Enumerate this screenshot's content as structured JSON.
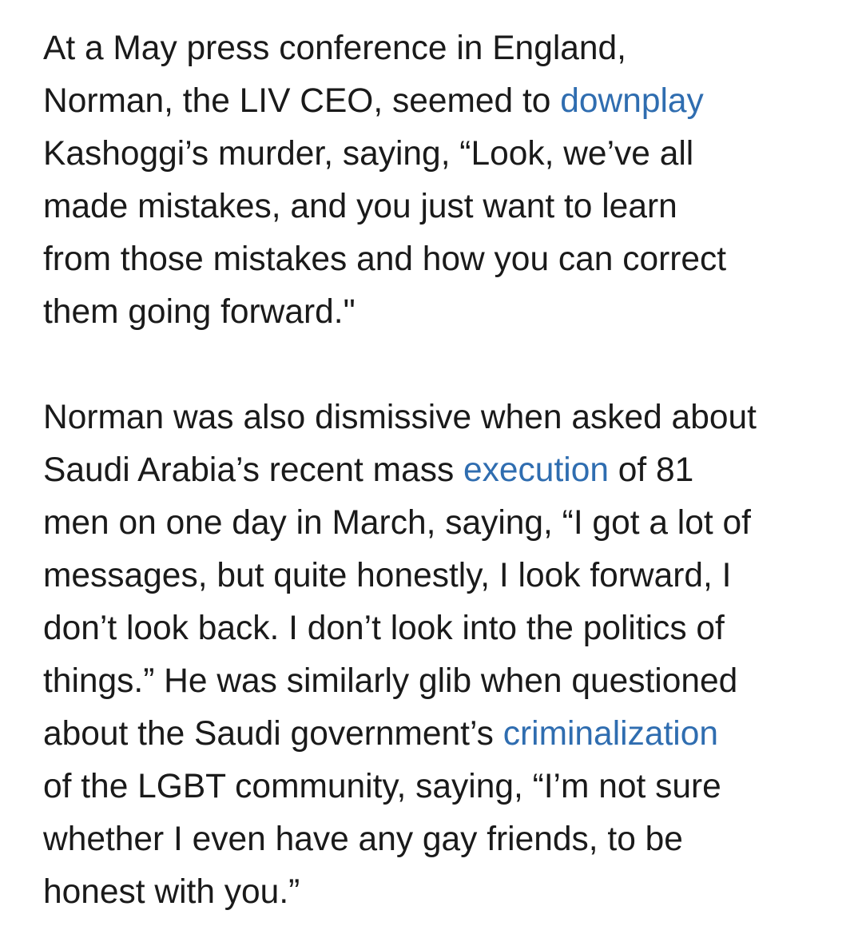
{
  "article": {
    "paragraph1": {
      "line1": "At a May press conference in England,",
      "line2_before": "Norman, the LIV CEO, seemed to ",
      "link_downplay": "downplay",
      "line3": "Kashoggi’s murder, saying, “Look, we’ve all",
      "line4": "made mistakes, and you just want to learn",
      "line5": "from those mistakes and how you can correct",
      "line6": "them going forward.\""
    },
    "paragraph2": {
      "line1": "Norman was also dismissive when asked about",
      "line2_before": "Saudi Arabia’s recent mass ",
      "link_execution": "execution",
      "line2_after": " of 81",
      "line3": "men on one day in March, saying, “I got a lot of",
      "line4": "messages, but quite honestly, I look forward, I",
      "line5": "don’t look back. I don’t look into the politics of",
      "line6": "things.” He was similarly glib when questioned",
      "line7_before": "about the Saudi government’s ",
      "link_criminalization": "criminalization",
      "line8": "of the LGBT community, saying, “I’m not sure",
      "line9": "whether I even have any gay friends, to be",
      "line10": "honest with you.”"
    },
    "link_color": "#2f6db0",
    "text_color": "#1a1a1a"
  }
}
